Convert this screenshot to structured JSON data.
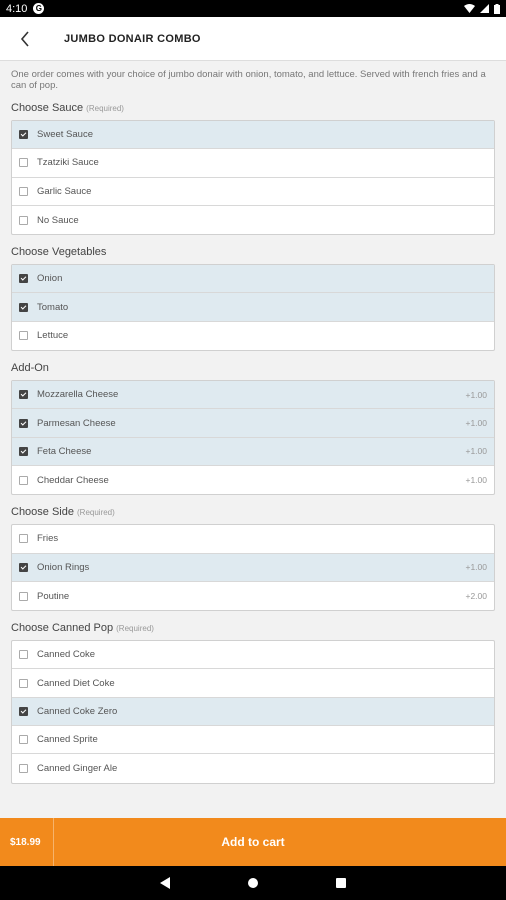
{
  "status": {
    "time": "4:10",
    "app_icon": "G"
  },
  "header": {
    "title": "JUMBO DONAIR COMBO"
  },
  "description": "One order comes with your choice of jumbo donair with onion, tomato, and lettuce. Served with french fries and a can of pop.",
  "groups": [
    {
      "title": "Choose Sauce",
      "required": "(Required)",
      "options": [
        {
          "label": "Sweet Sauce",
          "checked": true,
          "price": ""
        },
        {
          "label": "Tzatziki Sauce",
          "checked": false,
          "price": ""
        },
        {
          "label": "Garlic Sauce",
          "checked": false,
          "price": ""
        },
        {
          "label": "No Sauce",
          "checked": false,
          "price": ""
        }
      ]
    },
    {
      "title": "Choose Vegetables",
      "required": "",
      "options": [
        {
          "label": "Onion",
          "checked": true,
          "price": ""
        },
        {
          "label": "Tomato",
          "checked": true,
          "price": ""
        },
        {
          "label": "Lettuce",
          "checked": false,
          "price": ""
        }
      ]
    },
    {
      "title": "Add-On",
      "required": "",
      "options": [
        {
          "label": "Mozzarella Cheese",
          "checked": true,
          "price": "+1.00"
        },
        {
          "label": "Parmesan Cheese",
          "checked": true,
          "price": "+1.00"
        },
        {
          "label": "Feta Cheese",
          "checked": true,
          "price": "+1.00"
        },
        {
          "label": "Cheddar Cheese",
          "checked": false,
          "price": "+1.00"
        }
      ]
    },
    {
      "title": "Choose Side",
      "required": "(Required)",
      "options": [
        {
          "label": "Fries",
          "checked": false,
          "price": ""
        },
        {
          "label": "Onion Rings",
          "checked": true,
          "price": "+1.00"
        },
        {
          "label": "Poutine",
          "checked": false,
          "price": "+2.00"
        }
      ]
    },
    {
      "title": "Choose Canned Pop",
      "required": "(Required)",
      "options": [
        {
          "label": "Canned Coke",
          "checked": false,
          "price": ""
        },
        {
          "label": "Canned Diet Coke",
          "checked": false,
          "price": ""
        },
        {
          "label": "Canned Coke Zero",
          "checked": true,
          "price": ""
        },
        {
          "label": "Canned Sprite",
          "checked": false,
          "price": ""
        },
        {
          "label": "Canned Ginger Ale",
          "checked": false,
          "price": ""
        }
      ]
    }
  ],
  "cart": {
    "price": "$18.99",
    "label": "Add to cart"
  },
  "colors": {
    "accent": "#f28a1c",
    "selected_row": "#dfeaf0"
  },
  "icons": {
    "back": "chevron-left-icon",
    "nav": [
      "back-triangle-icon",
      "home-circle-icon",
      "recents-square-icon"
    ]
  }
}
